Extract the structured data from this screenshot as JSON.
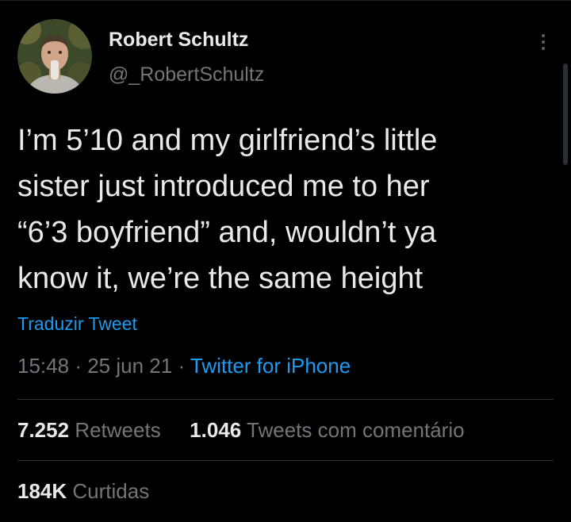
{
  "author": {
    "display_name": "Robert Schultz",
    "handle": "@_RobertSchultz"
  },
  "tweet": {
    "lines": [
      "I’m 5’10 and my girlfriend’s little",
      "sister just introduced me to her",
      "“6’3 boyfriend” and, wouldn’t ya",
      "know it, we’re the same height"
    ],
    "translate_label": "Traduzir Tweet",
    "time": "15:48",
    "date": "25 jun 21",
    "separator": "·",
    "source": "Twitter for iPhone"
  },
  "stats": {
    "retweets_count": "7.252",
    "retweets_label": "Retweets",
    "quotes_count": "1.046",
    "quotes_label": "Tweets com comentário",
    "likes_count": "184K",
    "likes_label": "Curtidas"
  },
  "icons": {
    "more": "more-vertical-icon"
  },
  "colors": {
    "background": "#000000",
    "text": "#e7e9ea",
    "secondary": "#71767b",
    "link": "#1d9bf0",
    "divider": "#2f3336"
  }
}
